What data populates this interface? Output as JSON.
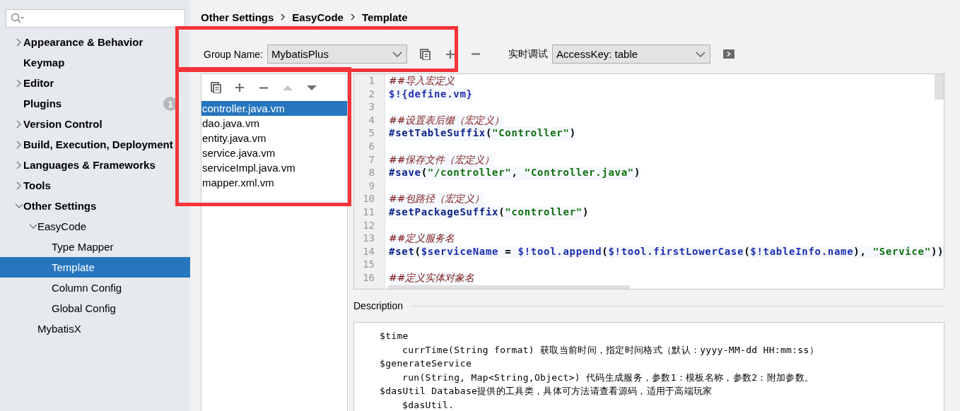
{
  "sidebar": {
    "items": [
      {
        "label": "Appearance & Behavior",
        "expanded": false,
        "selected": false
      },
      {
        "label": "Keymap",
        "selected": false
      },
      {
        "label": "Editor",
        "expanded": false,
        "selected": false
      },
      {
        "label": "Plugins",
        "selected": false,
        "badge": "1"
      },
      {
        "label": "Version Control",
        "expanded": false,
        "selected": false
      },
      {
        "label": "Build, Execution, Deployment",
        "expanded": false,
        "selected": false
      },
      {
        "label": "Languages & Frameworks",
        "expanded": false,
        "selected": false
      },
      {
        "label": "Tools",
        "expanded": false,
        "selected": false
      },
      {
        "label": "Other Settings",
        "expanded": true,
        "selected": false,
        "children": [
          {
            "label": "EasyCode",
            "expanded": true,
            "selected": false,
            "children": [
              {
                "label": "Type Mapper",
                "selected": false
              },
              {
                "label": "Template",
                "selected": true
              },
              {
                "label": "Column Config",
                "selected": false
              },
              {
                "label": "Global Config",
                "selected": false
              }
            ]
          },
          {
            "label": "MybatisX",
            "selected": false
          }
        ]
      }
    ]
  },
  "breadcrumb": [
    "Other Settings",
    "EasyCode",
    "Template"
  ],
  "toolbar": {
    "group_label": "Group Name:",
    "group_value": "MybatisPlus",
    "debug_label": "实时调试",
    "debug_value": "AccessKey: table"
  },
  "templates": {
    "toolbar": [
      {
        "kind": "copy",
        "disabled": false
      },
      {
        "kind": "add",
        "disabled": false
      },
      {
        "kind": "remove",
        "disabled": false
      },
      {
        "kind": "up",
        "disabled": true
      },
      {
        "kind": "down",
        "disabled": false
      }
    ],
    "items": [
      {
        "label": "controller.java.vm",
        "selected": true
      },
      {
        "label": "dao.java.vm",
        "selected": false
      },
      {
        "label": "entity.java.vm",
        "selected": false
      },
      {
        "label": "service.java.vm",
        "selected": false
      },
      {
        "label": "serviceImpl.java.vm",
        "selected": false
      },
      {
        "label": "mapper.xml.vm",
        "selected": false
      }
    ]
  },
  "editor": {
    "lines": [
      {
        "number": "1",
        "tokens": [
          {
            "kind": "comment",
            "text": "##导入宏定义"
          }
        ]
      },
      {
        "number": "2",
        "tokens": [
          {
            "kind": "var",
            "text": "$!{define.vm}"
          }
        ]
      },
      {
        "number": "3"
      },
      {
        "number": "4",
        "tokens": [
          {
            "kind": "comment",
            "text": "##设置表后缀（宏定义）"
          }
        ]
      },
      {
        "number": "5",
        "tokens": [
          {
            "kind": "directive",
            "text": "#setTableSuffix"
          },
          {
            "kind": "plain",
            "text": "("
          },
          {
            "kind": "string",
            "text": "\"Controller\""
          },
          {
            "kind": "plain",
            "text": ")"
          }
        ]
      },
      {
        "number": "6"
      },
      {
        "number": "7",
        "tokens": [
          {
            "kind": "comment",
            "text": "##保存文件（宏定义）"
          }
        ]
      },
      {
        "number": "8",
        "tokens": [
          {
            "kind": "directive",
            "text": "#save"
          },
          {
            "kind": "plain",
            "text": "("
          },
          {
            "kind": "string",
            "text": "\"/controller\""
          },
          {
            "kind": "plain",
            "text": ", "
          },
          {
            "kind": "string",
            "text": "\"Controller.java\""
          },
          {
            "kind": "plain",
            "text": ")"
          }
        ]
      },
      {
        "number": "9"
      },
      {
        "number": "10",
        "tokens": [
          {
            "kind": "comment",
            "text": "##包路径（宏定义）"
          }
        ]
      },
      {
        "number": "11",
        "tokens": [
          {
            "kind": "directive",
            "text": "#setPackageSuffix"
          },
          {
            "kind": "plain",
            "text": "("
          },
          {
            "kind": "string",
            "text": "\"controller\""
          },
          {
            "kind": "plain",
            "text": ")"
          }
        ]
      },
      {
        "number": "12"
      },
      {
        "number": "13",
        "tokens": [
          {
            "kind": "comment",
            "text": "##定义服务名"
          }
        ]
      },
      {
        "number": "14",
        "tokens": [
          {
            "kind": "directive",
            "text": "#set"
          },
          {
            "kind": "plain",
            "text": "("
          },
          {
            "kind": "var",
            "text": "$serviceName"
          },
          {
            "kind": "plain",
            "text": " = "
          },
          {
            "kind": "var",
            "text": "$!tool.append"
          },
          {
            "kind": "plain",
            "text": "("
          },
          {
            "kind": "var",
            "text": "$!tool.firstLowerCase"
          },
          {
            "kind": "plain",
            "text": "("
          },
          {
            "kind": "var",
            "text": "$!tableInfo.name"
          },
          {
            "kind": "plain",
            "text": "), "
          },
          {
            "kind": "string",
            "text": "\"Service\""
          },
          {
            "kind": "plain",
            "text": "))"
          }
        ]
      },
      {
        "number": "15"
      },
      {
        "number": "16",
        "tokens": [
          {
            "kind": "comment",
            "text": "##定义实体对象名"
          }
        ]
      }
    ]
  },
  "description": {
    "title": "Description",
    "entries": [
      {
        "text": "$time",
        "children": [
          {
            "text": "currTime(String format) 获取当前时间，指定时间格式（默认：yyyy-MM-dd HH:mm:ss）"
          }
        ]
      },
      {
        "text": "$generateService",
        "children": [
          {
            "text": "run(String, Map<String,Object>) 代码生成服务，参数1：模板名称，参数2：附加参数。"
          }
        ]
      },
      {
        "text": "$dasUtil Database提供的工具类，具体可方法请查看源码，适用于高端玩家",
        "children": [
          {
            "text": "$dasUtil."
          }
        ]
      }
    ]
  }
}
